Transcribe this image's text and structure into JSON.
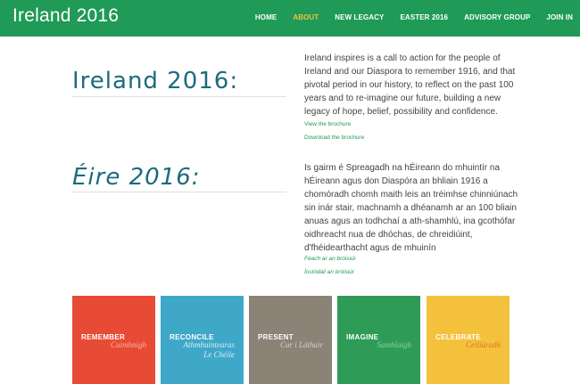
{
  "header": {
    "brand": "Ireland 2016",
    "nav": [
      {
        "label": "HOME",
        "active": false
      },
      {
        "label": "ABOUT",
        "active": true
      },
      {
        "label": "NEW LEGACY",
        "active": false
      },
      {
        "label": "EASTER 2016",
        "active": false
      },
      {
        "label": "ADVISORY GROUP",
        "active": false
      },
      {
        "label": "JOIN IN",
        "active": false
      }
    ]
  },
  "english": {
    "heading": "Ireland 2016:",
    "lines": [
      "Ireland inspires is a call to action for the people of",
      "Ireland and our Diaspora to remember 1916, and that",
      "pivotal period in our history, to reflect on the past 100",
      "years and to re-imagine our future, building a new",
      "legacy of hope, belief, possibility and confidence."
    ],
    "link_brochure": "View the brochure",
    "link_download": "Download the brochure"
  },
  "irish": {
    "heading": "Éire 2016:",
    "lines": [
      "Is gairm é Spreagadh na hÉireann do mhuintír na",
      "hÉireann agus don Diaspóra an bhliain 1916 a",
      "chomóradh chomh maith leis an tréimhse chinniúnach",
      "sin inár stair, machnamh a dhéanamh ar an 100 bliain",
      "anuas agus an todhchaí a ath-shamhlú, ina gcothófar",
      "oidhreacht nua de dhóchas, de chreidiúint,",
      "d'fhéidearthacht agus de mhuinín"
    ],
    "link_brochure": "Féach ar an bróisiúr",
    "link_download": "Íoslódáil an bróisiúr"
  },
  "tiles": [
    {
      "en": "REMEMBER",
      "ga": [
        "Cuimhnigh"
      ],
      "bg": "#e84b35",
      "ga_color": "#f7b5a5"
    },
    {
      "en": "RECONCILE",
      "ga": [
        "Athmhuintearas",
        "Le Chéile"
      ],
      "bg": "#3fa8c9",
      "ga_color": "#d4eef7"
    },
    {
      "en": "PRESENT",
      "ga": [
        "Cur i Láthair"
      ],
      "bg": "#8c8377",
      "ga_color": "#d8d2c8"
    },
    {
      "en": "IMAGINE",
      "ga": [
        "Samhlaigh"
      ],
      "bg": "#2e9b57",
      "ga_color": "#8fd49e"
    },
    {
      "en": "CELEBRATE",
      "ga": [
        "Ceiliúradh"
      ],
      "bg": "#f4c13c",
      "ga_color": "#e6731f"
    }
  ]
}
